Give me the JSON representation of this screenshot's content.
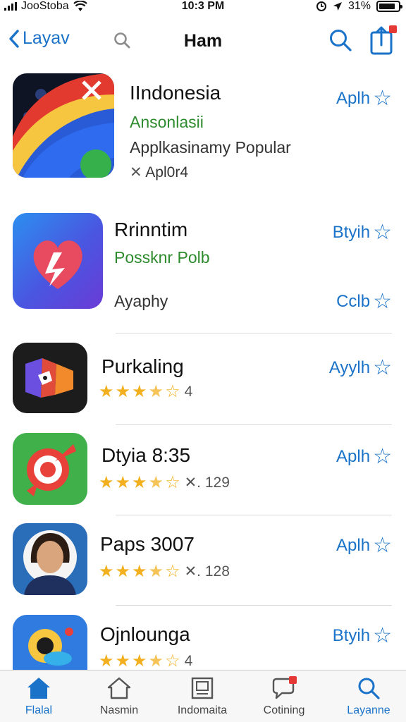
{
  "status_bar": {
    "carrier": "JooStoba",
    "time": "10:3 PM",
    "battery_text": "31%",
    "battery_level": 0.85
  },
  "nav": {
    "back_label": "Layav",
    "title": "Ham"
  },
  "apps": [
    {
      "name": "IIndonesia",
      "subtitle_green": "Ansonlasii",
      "subtitle": "Applkasinamy Popular",
      "meta": "Apl0r4",
      "action": "Aplh"
    },
    {
      "name": "Rrinntim",
      "subtitle_green": "Possknr Polb",
      "subtitle": "Ayaphy",
      "action": "Btyih",
      "secondary_action": "Cclb"
    },
    {
      "name": "Purkaling",
      "rating": 3.5,
      "rating_count": "4",
      "action": "Ayylh"
    },
    {
      "name": "Dtyia 8:35",
      "rating": 3.5,
      "rating_count": "129",
      "action": "Aplh"
    },
    {
      "name": "Paps 3007",
      "rating": 3.5,
      "rating_count": "128",
      "action": "Aplh"
    },
    {
      "name": "Ojnlounga",
      "rating": 3.5,
      "rating_count": "4",
      "action": "Btyih"
    }
  ],
  "tabs": [
    {
      "label": "Flalal",
      "icon": "house-filled-icon",
      "active": true
    },
    {
      "label": "Nasmin",
      "icon": "house-outline-icon",
      "active": false
    },
    {
      "label": "Indomaita",
      "icon": "document-icon",
      "active": false
    },
    {
      "label": "Cotining",
      "icon": "chat-badge-icon",
      "active": false
    },
    {
      "label": "Layanne",
      "icon": "search-icon",
      "active": false
    }
  ],
  "colors": {
    "accent": "#1a73c9",
    "green": "#2e8b2e",
    "star": "#f2b01e",
    "badge": "#e53935"
  }
}
